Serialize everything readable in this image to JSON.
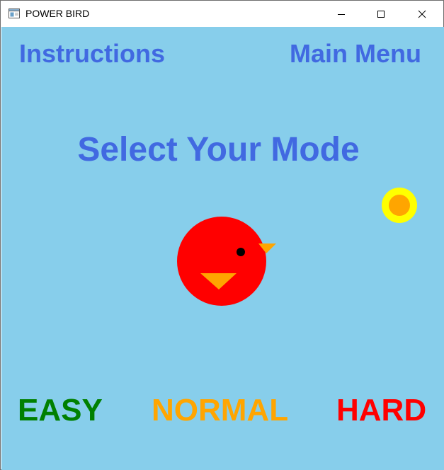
{
  "window": {
    "title": "POWER BIRD",
    "icon": "app-window-icon",
    "controls": [
      "minimize-icon",
      "maximize-icon",
      "close-icon"
    ]
  },
  "top_menu": {
    "instructions_label": "Instructions",
    "main_menu_label": "Main Menu"
  },
  "heading": "Select Your Mode",
  "modes": {
    "easy": {
      "label": "EASY",
      "color": "#008000"
    },
    "normal": {
      "label": "NORMAL",
      "color": "#ffa500"
    },
    "hard": {
      "label": "HARD",
      "color": "#ff0000"
    }
  },
  "colors": {
    "sky": "#87ceeb",
    "text_accent": "#4169e1",
    "bird_body": "#ff0000",
    "bird_beak": "#ffa500",
    "coin_outer": "#ffff00",
    "coin_inner": "#ffa500"
  }
}
